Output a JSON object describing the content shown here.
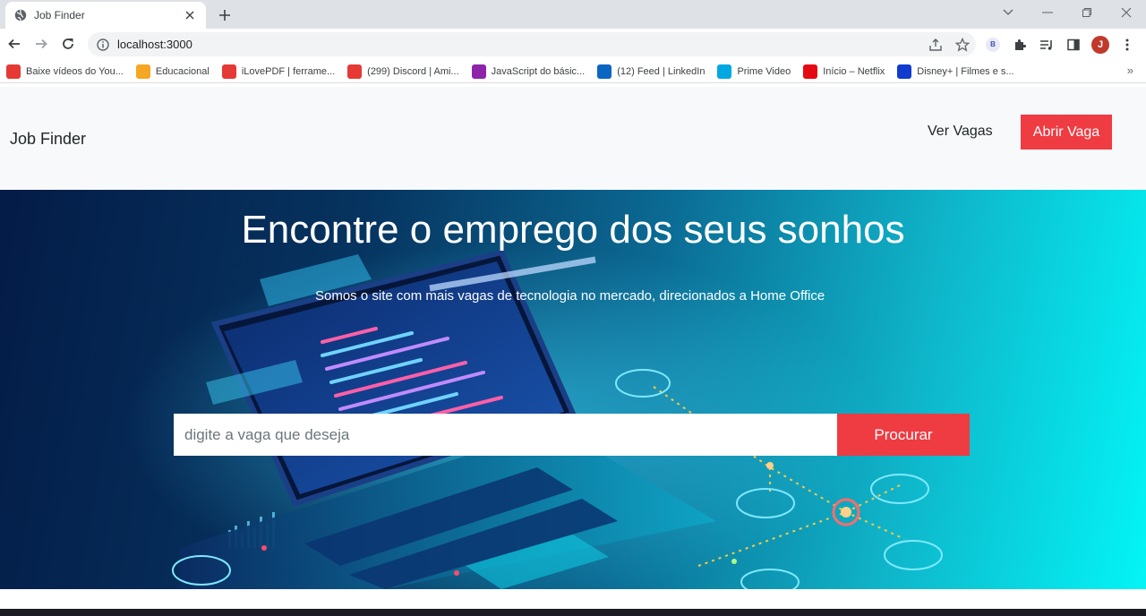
{
  "browser": {
    "tab_title": "Job Finder",
    "url": "localhost:3000",
    "avatar_letter": "J",
    "ext_badge": "B",
    "bookmarks": [
      {
        "label": "Baixe vídeos do You...",
        "color": "#e53935",
        "icon": "download-icon"
      },
      {
        "label": "Educacional",
        "color": "#f5a623",
        "icon": "folder-icon"
      },
      {
        "label": "iLovePDF | ferrame...",
        "color": "#e53935",
        "icon": "heart-icon"
      },
      {
        "label": "(299) Discord | Ami...",
        "color": "#e53935",
        "icon": "discord-icon"
      },
      {
        "label": "JavaScript do básic...",
        "color": "#8e24aa",
        "icon": "javascript-icon"
      },
      {
        "label": "(12) Feed | LinkedIn",
        "color": "#0a66c2",
        "icon": "linkedin-icon"
      },
      {
        "label": "Prime Video",
        "color": "#00a8e1",
        "icon": "play-icon"
      },
      {
        "label": "Início – Netflix",
        "color": "#e50914",
        "icon": "netflix-icon"
      },
      {
        "label": "Disney+ | Filmes e s...",
        "color": "#113ccf",
        "icon": "disney-icon"
      }
    ],
    "bookmark_more": "»"
  },
  "nav": {
    "brand": "Job Finder",
    "link_jobs": "Ver Vagas",
    "open_job_button": "Abrir Vaga"
  },
  "hero": {
    "title": "Encontre o emprego dos seus sonhos",
    "subtitle": "Somos o site com mais vagas de tecnologia no mercado, direcionados a Home Office",
    "search_placeholder": "digite a vaga que deseja",
    "search_button": "Procurar"
  },
  "colors": {
    "accent": "#ef3b42",
    "hero_dark": "#041c47",
    "hero_light": "#03f5f6"
  }
}
